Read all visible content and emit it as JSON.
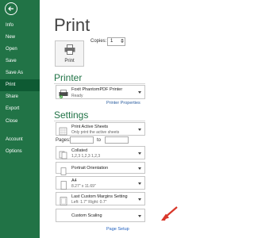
{
  "sidebar": {
    "items": [
      {
        "label": "Info"
      },
      {
        "label": "New"
      },
      {
        "label": "Open"
      },
      {
        "label": "Save"
      },
      {
        "label": "Save As"
      },
      {
        "label": "Print"
      },
      {
        "label": "Share"
      },
      {
        "label": "Export"
      },
      {
        "label": "Close"
      },
      {
        "label": "Account"
      },
      {
        "label": "Options"
      }
    ],
    "active": "Print",
    "background": "#217346"
  },
  "main": {
    "title": "Print",
    "print_button": {
      "label": "Print",
      "icon": "printer-icon"
    },
    "copies": {
      "label": "Copies:",
      "value": "1"
    }
  },
  "printer": {
    "heading": "Printer",
    "selected": {
      "name": "Foxit PhantomPDF Printer",
      "status": "Ready"
    },
    "properties_link": "Printer Properties"
  },
  "settings": {
    "heading": "Settings",
    "scope": {
      "title": "Print Active Sheets",
      "subtitle": "Only print the active sheets"
    },
    "pages": {
      "label": "Pages:",
      "to_label": "to",
      "from_value": "",
      "to_value": ""
    },
    "collation": {
      "title": "Collated",
      "subtitle": "1,2,3    1,2,3    1,2,3"
    },
    "orientation": {
      "title": "Portrait Orientation"
    },
    "paper": {
      "title": "A4",
      "subtitle": "8.27\" x 11.69\""
    },
    "margins": {
      "title": "Last Custom Margins Setting",
      "subtitle": "Left: 1.7\"   Right: 0.7\""
    },
    "scaling": {
      "title": "Custom Scaling"
    },
    "page_setup_link": "Page Setup"
  },
  "colors": {
    "accent": "#217346",
    "link": "#2a5d9f",
    "annotation": "#d9372a"
  }
}
